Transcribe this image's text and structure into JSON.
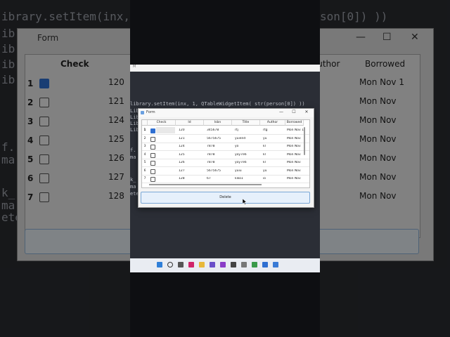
{
  "background": {
    "code_lines": [
      "ibrary.setItem(inx,",
      "ib",
      "ib",
      "ib",
      "ib",
      "f.",
      "ma",
      "k_",
      "ma",
      "ete"
    ],
    "right_code": "son[0]) ))",
    "form_title": "Form",
    "check_header": "Check",
    "row_numbers": [
      "1",
      "2",
      "3",
      "4",
      "5",
      "6",
      "7"
    ],
    "id_values": [
      "120",
      "121",
      "124",
      "125",
      "126",
      "127",
      "128"
    ],
    "author_header": "Author",
    "borrowed_header": "Borrowed",
    "borrowed_values": [
      "Mon Nov 1",
      "Mon Nov",
      "Mon Nov",
      "Mon Nov",
      "Mon Nov",
      "Mon Nov",
      "Mon Nov"
    ],
    "win_minimize": "—",
    "win_maximize": "☐",
    "win_close": "✕"
  },
  "screen": {
    "topbar_label": "M",
    "code_line": "library.setItem(inx, 1, QTableWidgetItem( str(person[0]) ))",
    "side_code": [
      "Lib",
      "Lib",
      "Lib",
      "Lib",
      "f.",
      "ma",
      "k_",
      "ma",
      "ete"
    ]
  },
  "form": {
    "title": "Form",
    "minimize": "—",
    "maximize": "☐",
    "close": "✕",
    "columns": [
      "Check",
      "Id",
      "Isbn",
      "Title",
      "Author",
      "Borrowed"
    ],
    "rows": [
      {
        "num": "1",
        "checked": true,
        "id": "120",
        "isbn": "345678",
        "title": "rtj",
        "author": "rtg",
        "borrowed": "Mon Nov 1"
      },
      {
        "num": "2",
        "checked": false,
        "id": "121",
        "isbn": "5675675",
        "title": "yuiend",
        "author": "yu",
        "borrowed": "Mon Nov"
      },
      {
        "num": "3",
        "checked": false,
        "id": "124",
        "isbn": "7878",
        "title": "yo",
        "author": "kl",
        "borrowed": "Mon Nov"
      },
      {
        "num": "4",
        "checked": false,
        "id": "125",
        "isbn": "7878",
        "title": "yoy7e6",
        "author": "kl",
        "borrowed": "Mon Nov"
      },
      {
        "num": "5",
        "checked": false,
        "id": "126",
        "isbn": "7878",
        "title": "yoy7e6",
        "author": "kl",
        "borrowed": "Mon Nov"
      },
      {
        "num": "6",
        "checked": false,
        "id": "127",
        "isbn": "5675675",
        "title": "yuiu",
        "author": "yu",
        "borrowed": "Mon Nov"
      },
      {
        "num": "7",
        "checked": false,
        "id": "128",
        "isbn": "67",
        "title": "kiko1",
        "author": "io",
        "borrowed": "Mon Nov"
      }
    ],
    "delete_label": "Delete"
  },
  "taskbar": {
    "icons": [
      "windows-icon",
      "search-icon",
      "task-view-icon",
      "browser-icon",
      "folder-icon",
      "app-icon",
      "media-icon",
      "app2-icon",
      "settings-icon",
      "chat-icon",
      "terminal-icon",
      "python-icon"
    ]
  }
}
